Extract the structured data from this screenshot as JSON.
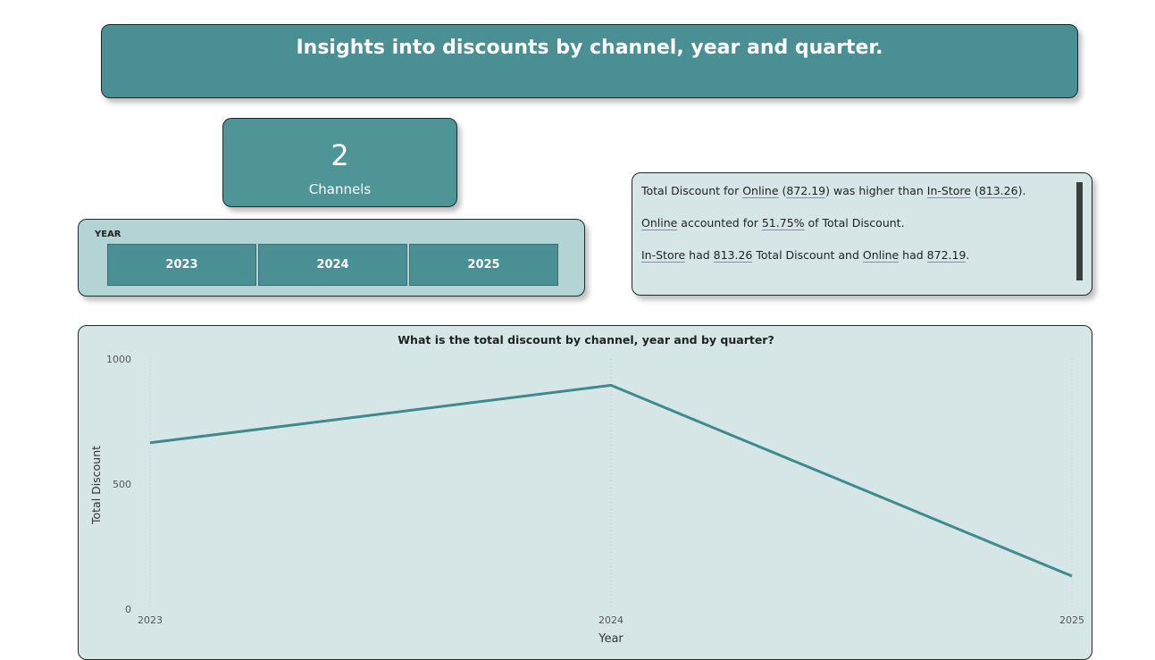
{
  "header": {
    "title": "Insights into discounts by channel, year and quarter."
  },
  "kpi": {
    "value": "2",
    "label": "Channels"
  },
  "slicer": {
    "title": "YEAR",
    "options": [
      "2023",
      "2024",
      "2025"
    ]
  },
  "narrative": {
    "line1": {
      "p1": "Total Discount for ",
      "online": "Online",
      "p2": " (",
      "online_value": "872.19",
      "p3": ") was higher than ",
      "instore": "In-Store",
      "p4": " (",
      "instore_value": "813.26",
      "p5": ")."
    },
    "line2": {
      "online": "Online",
      "p1": " accounted for ",
      "pct": "51.75%",
      "p2": " of Total Discount."
    },
    "line3": {
      "instore": "In-Store",
      "p1": " had ",
      "instore_value": "813.26",
      "p2": " Total Discount and ",
      "online": "Online",
      "p3": " had ",
      "online_value": "872.19",
      "p4": "."
    }
  },
  "chart_data": {
    "type": "line",
    "title": "What is the total discount by channel, year and by quarter?",
    "xlabel": "Year",
    "ylabel": "Total Discount",
    "x": [
      "2023",
      "2024",
      "2025"
    ],
    "y_ticks": [
      "0",
      "500",
      "1000"
    ],
    "ylim": [
      0,
      1000
    ],
    "series": [
      {
        "values": [
          665,
          895,
          132
        ]
      }
    ],
    "grid": "vertical-dotted",
    "line_color": "#3f8a8f"
  }
}
